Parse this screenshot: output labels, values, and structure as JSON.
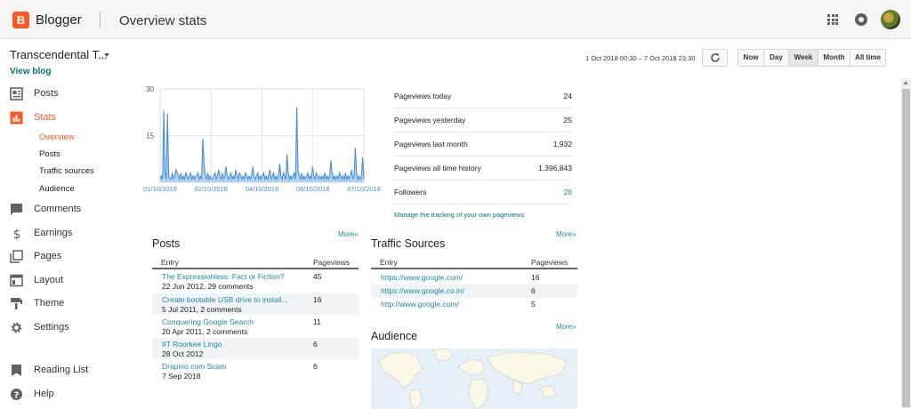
{
  "header": {
    "brand": "Blogger",
    "logo_letter": "B",
    "title": "Overview stats",
    "icons": [
      "apps-icon",
      "notifications-icon",
      "avatar"
    ]
  },
  "blog": {
    "name": "Transcendental T...",
    "view_blog": "View blog"
  },
  "sidebar": {
    "items": [
      {
        "label": "Posts",
        "icon": "posts-icon"
      },
      {
        "label": "Stats",
        "icon": "stats-icon",
        "active": true
      },
      {
        "label": "Comments",
        "icon": "comments-icon"
      },
      {
        "label": "Earnings",
        "icon": "dollar-icon"
      },
      {
        "label": "Pages",
        "icon": "pages-icon"
      },
      {
        "label": "Layout",
        "icon": "layout-icon"
      },
      {
        "label": "Theme",
        "icon": "theme-icon"
      },
      {
        "label": "Settings",
        "icon": "gear-icon"
      },
      {
        "label": "Reading List",
        "icon": "bookmark-icon"
      },
      {
        "label": "Help",
        "icon": "help-icon"
      }
    ],
    "stats_sub": [
      "Overview",
      "Posts",
      "Traffic sources",
      "Audience"
    ]
  },
  "controls": {
    "date_range": "1 Oct 2018 00:30 – 7 Oct 2018 23:30",
    "periods": [
      "Now",
      "Day",
      "Week",
      "Month",
      "All time"
    ],
    "active_period": "Week"
  },
  "chart_data": {
    "type": "area",
    "title": "",
    "xlabel": "",
    "ylabel": "",
    "ylim": [
      0,
      30
    ],
    "yticks": [
      15,
      30
    ],
    "xticks": [
      "01/10/2018",
      "02/10/2018",
      "04/10/2018",
      "06/10/2018",
      "07/10/2018"
    ],
    "x": [
      0,
      1,
      2,
      3,
      4,
      5,
      6,
      7,
      8,
      9,
      10,
      11,
      12,
      13,
      14,
      15,
      16,
      17,
      18,
      19,
      20,
      21,
      22,
      23,
      24,
      25,
      26,
      27,
      28,
      29,
      30,
      31,
      32,
      33,
      34,
      35,
      36,
      37,
      38,
      39,
      40,
      41,
      42,
      43,
      44,
      45,
      46,
      47,
      48,
      49,
      50,
      51,
      52,
      53,
      54,
      55,
      56,
      57,
      58,
      59,
      60,
      61,
      62,
      63,
      64,
      65,
      66,
      67,
      68,
      69,
      70,
      71,
      72,
      73,
      74,
      75,
      76,
      77,
      78,
      79,
      80,
      81,
      82,
      83,
      84,
      85,
      86,
      87,
      88,
      89,
      90,
      91,
      92,
      93,
      94,
      95,
      96,
      97,
      98,
      99,
      100,
      101,
      102,
      103,
      104,
      105,
      106,
      107,
      108,
      109,
      110,
      111,
      112,
      113,
      114,
      115,
      116,
      117,
      118,
      119,
      120,
      121,
      122,
      123,
      124,
      125,
      126,
      127,
      128,
      129,
      130,
      131,
      132,
      133,
      134,
      135,
      136,
      137,
      138,
      139,
      140,
      141,
      142,
      143,
      144,
      145,
      146,
      147,
      148,
      149,
      150,
      151,
      152,
      153,
      154,
      155,
      156,
      157,
      158,
      159,
      160,
      161,
      162,
      163,
      164,
      165,
      166,
      167
    ],
    "values": [
      1,
      2,
      1,
      23,
      3,
      1,
      22,
      2,
      1,
      1,
      3,
      1,
      2,
      4,
      3,
      2,
      1,
      3,
      1,
      2,
      1,
      3,
      2,
      1,
      2,
      3,
      1,
      2,
      1,
      2,
      2,
      3,
      1,
      2,
      1,
      14,
      6,
      2,
      1,
      3,
      1,
      2,
      1,
      1,
      2,
      3,
      1,
      2,
      4,
      2,
      1,
      3,
      1,
      2,
      5,
      2,
      1,
      2,
      3,
      1,
      2,
      1,
      4,
      2,
      1,
      3,
      2,
      1,
      2,
      1,
      3,
      2,
      1,
      2,
      1,
      2,
      5,
      2,
      1,
      2,
      3,
      1,
      2,
      1,
      2,
      3,
      1,
      2,
      1,
      2,
      4,
      1,
      2,
      3,
      1,
      2,
      1,
      2,
      6,
      2,
      1,
      3,
      2,
      1,
      9,
      3,
      1,
      2,
      1,
      2,
      3,
      1,
      24,
      4,
      2,
      1,
      3,
      1,
      2,
      1,
      2,
      3,
      1,
      2,
      1,
      5,
      2,
      1,
      3,
      2,
      1,
      2,
      1,
      2,
      1,
      3,
      1,
      2,
      1,
      2,
      7,
      3,
      1,
      2,
      1,
      2,
      1,
      3,
      2,
      1,
      2,
      1,
      3,
      1,
      2,
      1,
      2,
      4,
      1,
      2,
      11,
      3,
      1,
      2,
      1,
      2,
      8,
      1
    ]
  },
  "summary": [
    {
      "label": "Pageviews today",
      "value": "24"
    },
    {
      "label": "Pageviews yesterday",
      "value": "25"
    },
    {
      "label": "Pageviews last month",
      "value": "1,932"
    },
    {
      "label": "Pageviews all time history",
      "value": "1,396,843"
    },
    {
      "label": "Followers",
      "value": "28",
      "link": true
    }
  ],
  "manage_link": "Manage the tracking of your own pageviews",
  "more_label": "More»",
  "posts": {
    "title": "Posts",
    "columns": [
      "Entry",
      "Pageviews"
    ],
    "rows": [
      {
        "entry": "The Expressionless: Fact or Fiction?",
        "meta": "22 Jun 2012, 29 comments",
        "views": "45"
      },
      {
        "entry": "Create bootable USB drive to install...",
        "meta": "5 Jul 2011, 2 comments",
        "views": "16"
      },
      {
        "entry": "Conquering Google Search",
        "meta": "20 Apr 2011, 2 comments",
        "views": "11"
      },
      {
        "entry": "IIT Roorkee Lingo",
        "meta": "28 Oct 2012",
        "views": "6"
      },
      {
        "entry": "Drapino.com Scam",
        "meta": "7 Sep 2018",
        "views": "6"
      }
    ]
  },
  "traffic": {
    "title": "Traffic Sources",
    "columns": [
      "Entry",
      "Pageviews"
    ],
    "rows": [
      {
        "entry": "https://www.google.com/",
        "views": "16"
      },
      {
        "entry": "https://www.google.co.in/",
        "views": "6"
      },
      {
        "entry": "http://www.google.com/",
        "views": "5"
      }
    ]
  },
  "audience": {
    "title": "Audience"
  },
  "colors": {
    "accent": "#ff5722",
    "link": "#1e88a8",
    "chart_fill": "#b3d4f0",
    "chart_line": "#4a90d9"
  }
}
